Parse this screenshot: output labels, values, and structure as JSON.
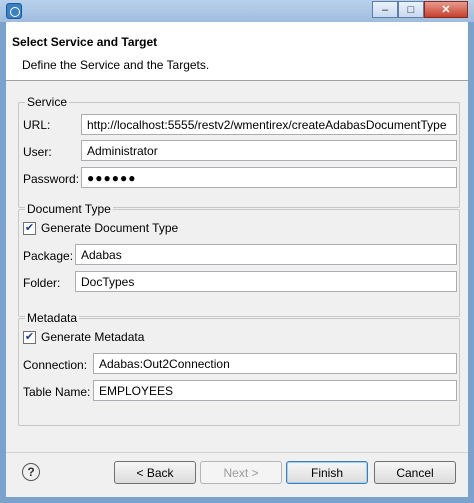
{
  "window": {
    "minimize_glyph": "–",
    "maximize_glyph": "□",
    "close_glyph": "✕"
  },
  "header": {
    "title": "Select Service and Target",
    "description": "Define the Service and the Targets."
  },
  "service": {
    "group_title": "Service",
    "url_label": "URL:",
    "url_value": "http://localhost:5555/restv2/wmentirex/createAdabasDocumentType",
    "user_label": "User:",
    "user_value": "Administrator",
    "password_label": "Password:",
    "password_value": "●●●●●●"
  },
  "document_type": {
    "group_title": "Document Type",
    "generate_label": "Generate Document Type",
    "generate_checked": true,
    "package_label": "Package:",
    "package_value": "Adabas",
    "folder_label": "Folder:",
    "folder_value": "DocTypes"
  },
  "metadata": {
    "group_title": "Metadata",
    "generate_label": "Generate Metadata",
    "generate_checked": true,
    "connection_label": "Connection:",
    "connection_value": "Adabas:Out2Connection",
    "table_name_label": "Table Name:",
    "table_name_value": "EMPLOYEES"
  },
  "footer": {
    "help_glyph": "?",
    "back_label": "< Back",
    "next_label": "Next >",
    "finish_label": "Finish",
    "cancel_label": "Cancel"
  },
  "check_glyph": "✔"
}
